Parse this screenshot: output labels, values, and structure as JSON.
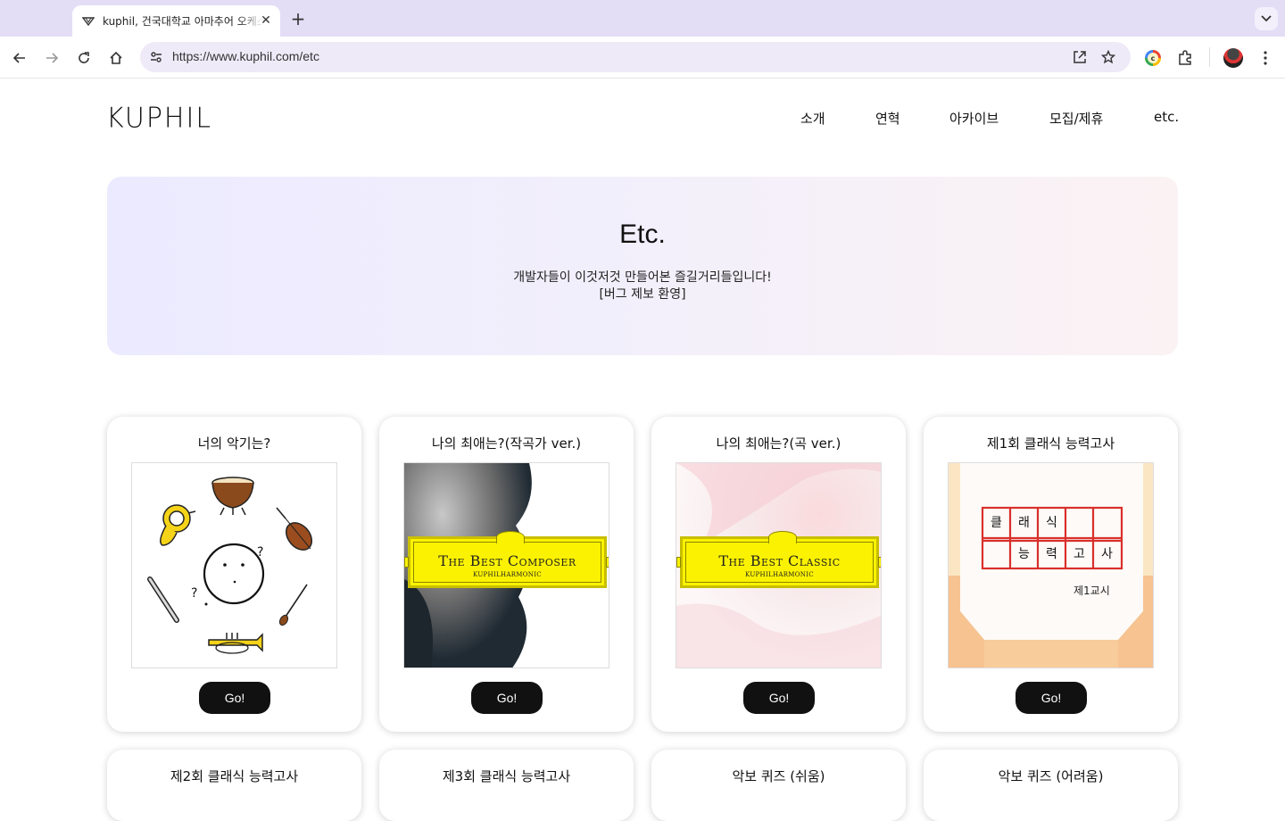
{
  "browser": {
    "tab_title": "kuphil, 건국대학교 아마추어 오케스트라",
    "url": "https://www.kuphil.com/etc"
  },
  "site": {
    "logo": "KUPHIL",
    "nav": [
      "소개",
      "연혁",
      "아카이브",
      "모집/제휴",
      "etc."
    ]
  },
  "hero": {
    "title": "Etc.",
    "subtitle_line1": "개발자들이 이것저것 만들어본 즐길거리들입니다!",
    "subtitle_line2": "[버그 제보 환영]"
  },
  "cards": [
    {
      "title": "너의 악기는?",
      "button": "Go!"
    },
    {
      "title": "나의 최애는?(작곡가 ver.)",
      "button": "Go!",
      "album_title": "The Best Composer",
      "album_sub": "KUPHILHARMONIC"
    },
    {
      "title": "나의 최애는?(곡 ver.)",
      "button": "Go!",
      "album_title": "The Best Classic",
      "album_sub": "KUPHILHARMONIC"
    },
    {
      "title": "제1회 클래식 능력고사",
      "button": "Go!",
      "grid_row1": [
        "클",
        "래",
        "식",
        "",
        ""
      ],
      "grid_row2": [
        "",
        "능",
        "력",
        "고",
        "사"
      ],
      "caption": "제1교시"
    },
    {
      "title": "제2회 클래식 능력고사"
    },
    {
      "title": "제3회 클래식 능력고사"
    },
    {
      "title": "악보 퀴즈 (쉬움)"
    },
    {
      "title": "악보 퀴즈 (어려움)"
    }
  ],
  "colors": {
    "accent_black": "#111111",
    "album_yellow": "#fbf201",
    "exam_red": "#d9302c"
  }
}
